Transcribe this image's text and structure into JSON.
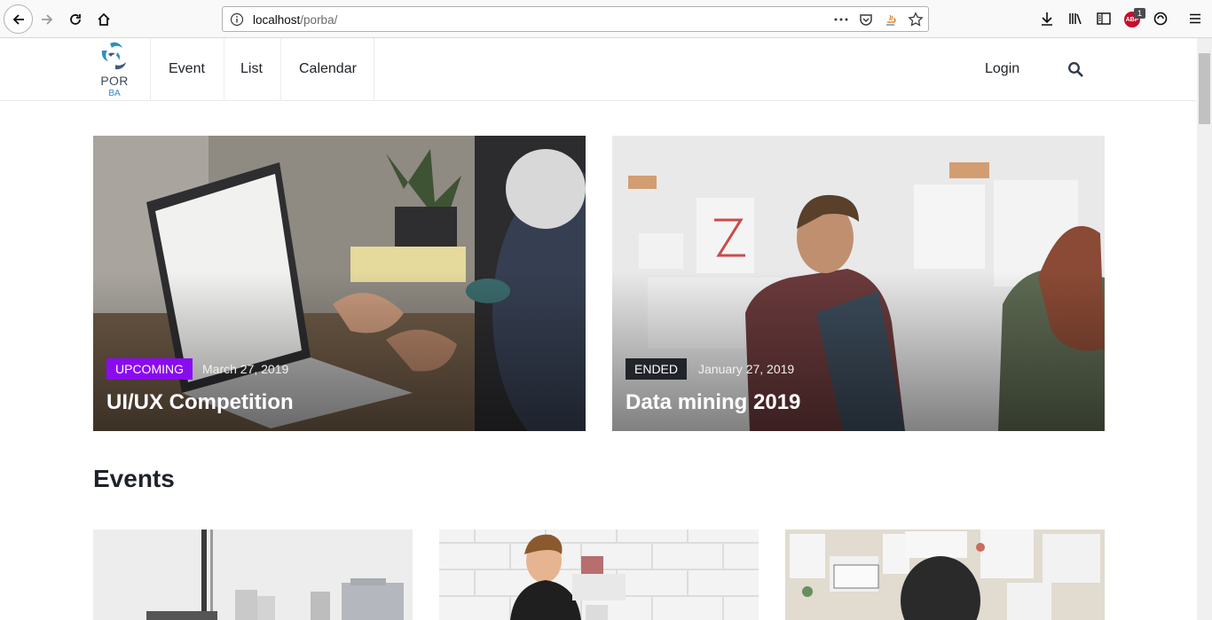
{
  "browser": {
    "url_host": "localhost",
    "url_path": "/porba/",
    "icons": [
      "back-icon",
      "forward-icon",
      "reload-icon",
      "home-icon",
      "page-info-icon",
      "page-actions-icon",
      "pocket-icon",
      "java-icon",
      "bookmark-star-icon",
      "download-icon",
      "library-icon",
      "sidebar-icon",
      "adblock-icon",
      "sync-icon",
      "menu-icon"
    ],
    "adblock_count": "1"
  },
  "site": {
    "logo_top": "POR",
    "logo_bottom": "BA",
    "nav": [
      {
        "label": "Event"
      },
      {
        "label": "List"
      },
      {
        "label": "Calendar"
      }
    ],
    "login_label": "Login"
  },
  "featured": [
    {
      "status": "UPCOMING",
      "status_color": "#8a0bf2",
      "date": "March 27, 2019",
      "title": "UI/UX Competition"
    },
    {
      "status": "ENDED",
      "status_color": "#212529",
      "date": "January 27, 2019",
      "title": "Data mining 2019"
    }
  ],
  "events_section": {
    "title": "Events"
  },
  "colors": {
    "accent_upcoming": "#8a0bf2",
    "badge_ended": "#212529",
    "logo_blue": "#2b8fc4"
  }
}
